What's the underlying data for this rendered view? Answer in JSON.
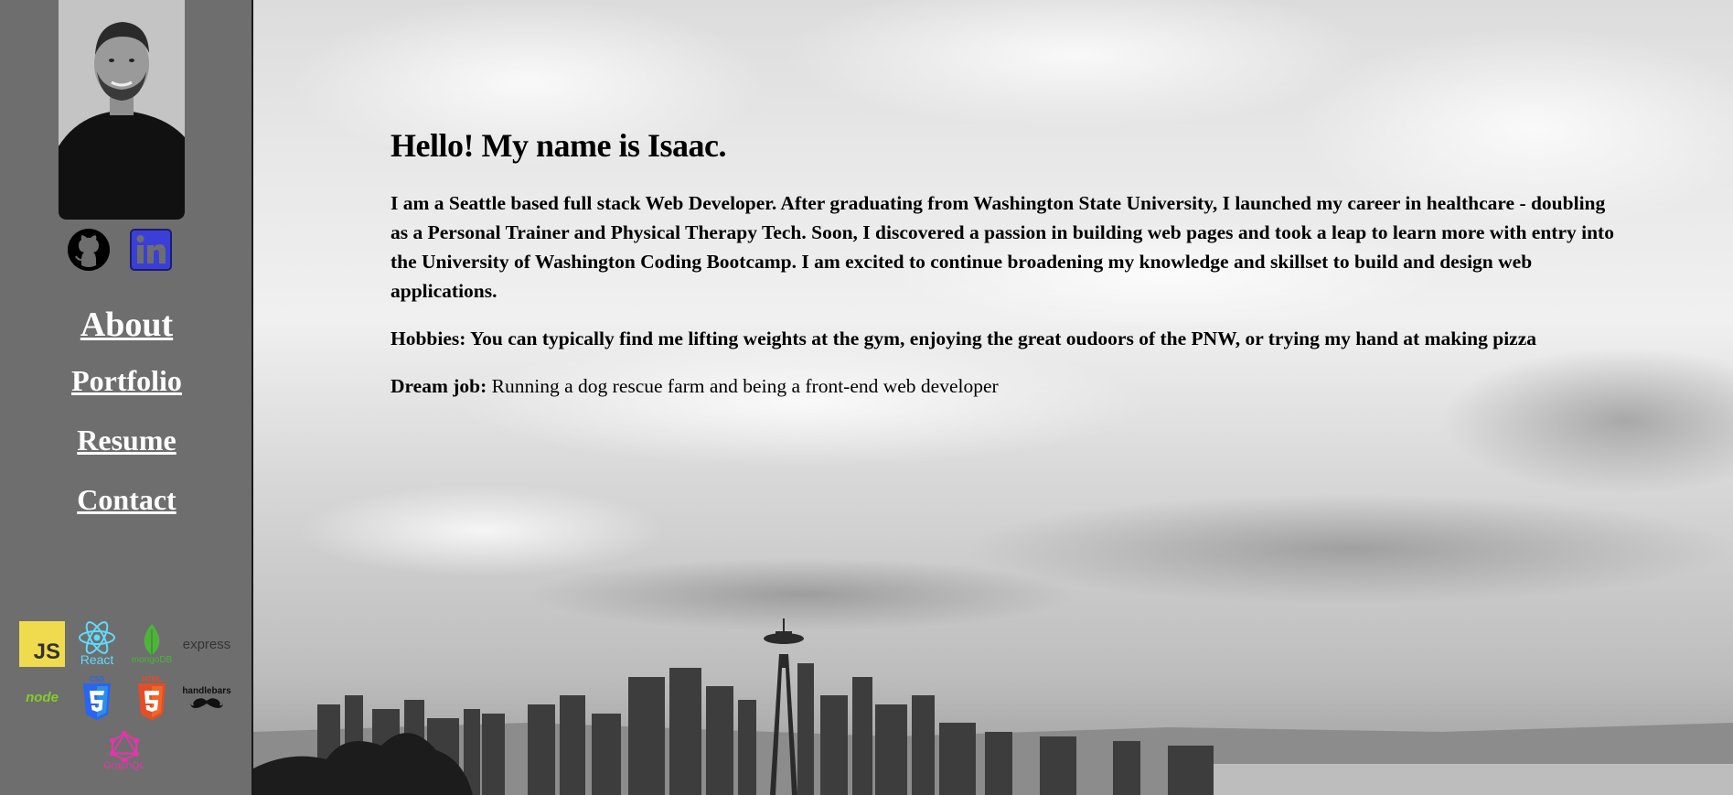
{
  "sidebar": {
    "photo_alt": "Isaac",
    "social": [
      {
        "name": "github-icon"
      },
      {
        "name": "linkedin-icon"
      }
    ],
    "nav": {
      "about": "About",
      "portfolio": "Portfolio",
      "resume": "Resume",
      "contact": "Contact"
    },
    "tech_labels": {
      "js": "JS",
      "react": "React",
      "mongodb": "mongoDB",
      "express": "express",
      "node": "node",
      "css3": "CSS",
      "html5": "HTML",
      "handlebars": "handlebars",
      "graphql": "GraphQL"
    }
  },
  "main": {
    "heading": "Hello! My name is Isaac.",
    "bio": "I am a Seattle based full stack Web Developer. After graduating from Washington State University, I launched my career in healthcare - doubling as a Personal Trainer and Physical Therapy Tech. Soon, I discovered a passion in building web pages and took a leap to learn more with entry into the University of Washington Coding Bootcamp. I am excited to continue broadening my knowledge and skillset to build and design web applications.",
    "hobbies_label": "Hobbies:",
    "hobbies_text": " You can typically find me lifting weights at the gym, enjoying the great oudoors of the PNW, or trying my hand at making pizza",
    "dream_label": "Dream job:",
    "dream_text": " Running a dog rescue farm and being a front-end web developer"
  },
  "colors": {
    "sidebar_bg": "#6e6e6e",
    "linkedin_blue": "#3b3fd8",
    "js_yellow": "#f0db4f",
    "react_blue": "#61dafb",
    "mongo_green": "#4db33d",
    "html5_red": "#e44d26",
    "css3_blue": "#2965f1",
    "graphql_pink": "#e535ab"
  }
}
